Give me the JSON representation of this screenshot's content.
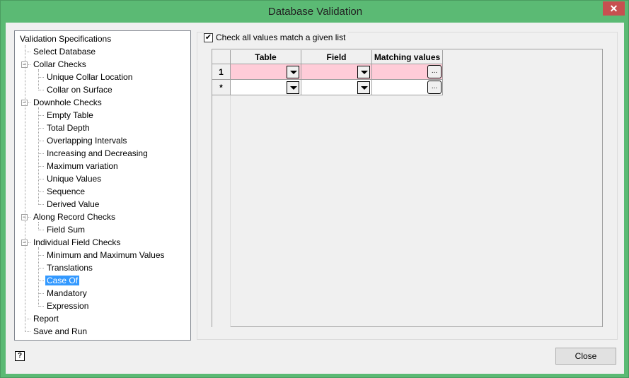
{
  "window": {
    "title": "Database Validation",
    "close_glyph": "✕"
  },
  "tree": {
    "items": [
      {
        "label": "Validation Specifications",
        "level": 0
      },
      {
        "label": "Select Database",
        "level": 1
      },
      {
        "label": "Collar Checks",
        "level": 1,
        "expanded": true
      },
      {
        "label": "Unique Collar Location",
        "level": 2
      },
      {
        "label": "Collar on Surface",
        "level": 2
      },
      {
        "label": "Downhole Checks",
        "level": 1,
        "expanded": true
      },
      {
        "label": "Empty Table",
        "level": 2
      },
      {
        "label": "Total Depth",
        "level": 2
      },
      {
        "label": "Overlapping Intervals",
        "level": 2
      },
      {
        "label": "Increasing and Decreasing",
        "level": 2
      },
      {
        "label": "Maximum variation",
        "level": 2
      },
      {
        "label": "Unique Values",
        "level": 2
      },
      {
        "label": "Sequence",
        "level": 2
      },
      {
        "label": "Derived Value",
        "level": 2
      },
      {
        "label": "Along Record Checks",
        "level": 1,
        "expanded": true
      },
      {
        "label": "Field Sum",
        "level": 2
      },
      {
        "label": "Individual Field Checks",
        "level": 1,
        "expanded": true
      },
      {
        "label": "Minimum and Maximum Values",
        "level": 2
      },
      {
        "label": "Translations",
        "level": 2
      },
      {
        "label": "Case Of",
        "level": 2,
        "selected": true
      },
      {
        "label": "Mandatory",
        "level": 2
      },
      {
        "label": "Expression",
        "level": 2
      },
      {
        "label": "Report",
        "level": 1
      },
      {
        "label": "Save and Run",
        "level": 1
      }
    ]
  },
  "panel": {
    "checkbox_label": "Check all values match a given list",
    "checked": true,
    "check_glyph": "✔"
  },
  "grid": {
    "columns": [
      "Table",
      "Field",
      "Matching values"
    ],
    "rows": [
      {
        "header": "1",
        "table": "",
        "field": "",
        "matching": ""
      },
      {
        "header": "*",
        "table": "",
        "field": "",
        "matching": ""
      }
    ],
    "ellipsis": "..."
  },
  "footer": {
    "help_glyph": "?",
    "close_label": "Close"
  }
}
